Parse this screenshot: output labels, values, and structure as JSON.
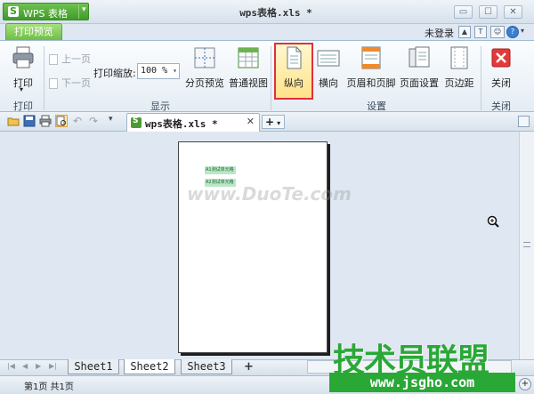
{
  "app": {
    "name": "WPS 表格",
    "window_title": "wps表格.xls *",
    "menu_arrow": "▾"
  },
  "window_controls": {
    "restore": "▭",
    "minimize": "—",
    "maximize": "☐",
    "close": "✕"
  },
  "ribbon_tab": "打印预览",
  "login": "未登录",
  "ribbon": {
    "print": {
      "label": "打印",
      "dropdown": "▾",
      "group": "打印"
    },
    "display": {
      "prev_page": "上一页",
      "next_page": "下一页",
      "zoom_label": "打印缩放:",
      "zoom_value": "100 %",
      "page_break_preview": "分页预览",
      "normal_view": "普通视图",
      "group": "显示"
    },
    "settings": {
      "portrait": "纵向",
      "landscape": "横向",
      "header_footer": "页眉和页脚",
      "page_setup": "页面设置",
      "margins": "页边距",
      "group": "设置"
    },
    "close": {
      "label": "关闭",
      "group": "关闭"
    }
  },
  "doc_tab": {
    "title": "wps表格.xls *",
    "close": "✕",
    "new": "+"
  },
  "page_preview": {
    "cells": [
      "A1测试单元格",
      "A2测试单元格"
    ]
  },
  "watermark_duote": "www.DuoTe.com",
  "sheets": [
    "Sheet1",
    "Sheet2",
    "Sheet3"
  ],
  "active_sheet": 1,
  "add_sheet": "+",
  "status": "第1页 共1页",
  "watermark_brand": {
    "big": "技术员联盟",
    "url": "www.jsgho.com"
  }
}
